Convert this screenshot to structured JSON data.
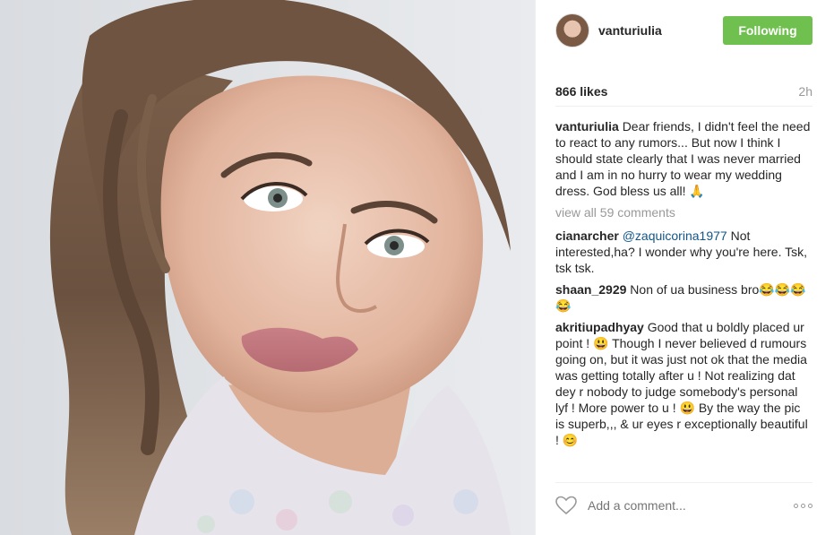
{
  "post": {
    "username": "vanturiulia",
    "follow_label": "Following",
    "likes": "866 likes",
    "time": "2h",
    "caption_user": "vanturiulia",
    "caption_text": "Dear friends, I didn't feel the need to react to any rumors... But now I think I should state clearly that I was never married and I am in no hurry to wear my wedding dress. God bless us all! 🙏",
    "view_all": "view all 59 comments"
  },
  "comments": [
    {
      "user": "cianarcher",
      "mention": "@zaquicorina1977",
      "text": " Not interested,ha? I wonder why you're here. Tsk, tsk tsk."
    },
    {
      "user": "shaan_2929",
      "mention": "",
      "text": " Non of ua business bro😂😂😂😂"
    },
    {
      "user": "akritiupadhyay",
      "mention": "",
      "text": " Good that u boldly placed ur point ! 😃 Though I never believed d rumours going on, but it was just not ok that the media was getting totally after u ! Not realizing dat dey r nobody to judge somebody's personal lyf ! More power to u ! 😃 By the way the pic is superb,,, & ur eyes r exceptionally beautiful ! 😊"
    }
  ],
  "footer": {
    "comment_placeholder": "Add a comment..."
  },
  "icons": {
    "heart": "heart-icon",
    "more": "more-options-icon"
  },
  "colors": {
    "follow_button": "#70c050",
    "mention": "#125688",
    "muted": "#999999"
  }
}
